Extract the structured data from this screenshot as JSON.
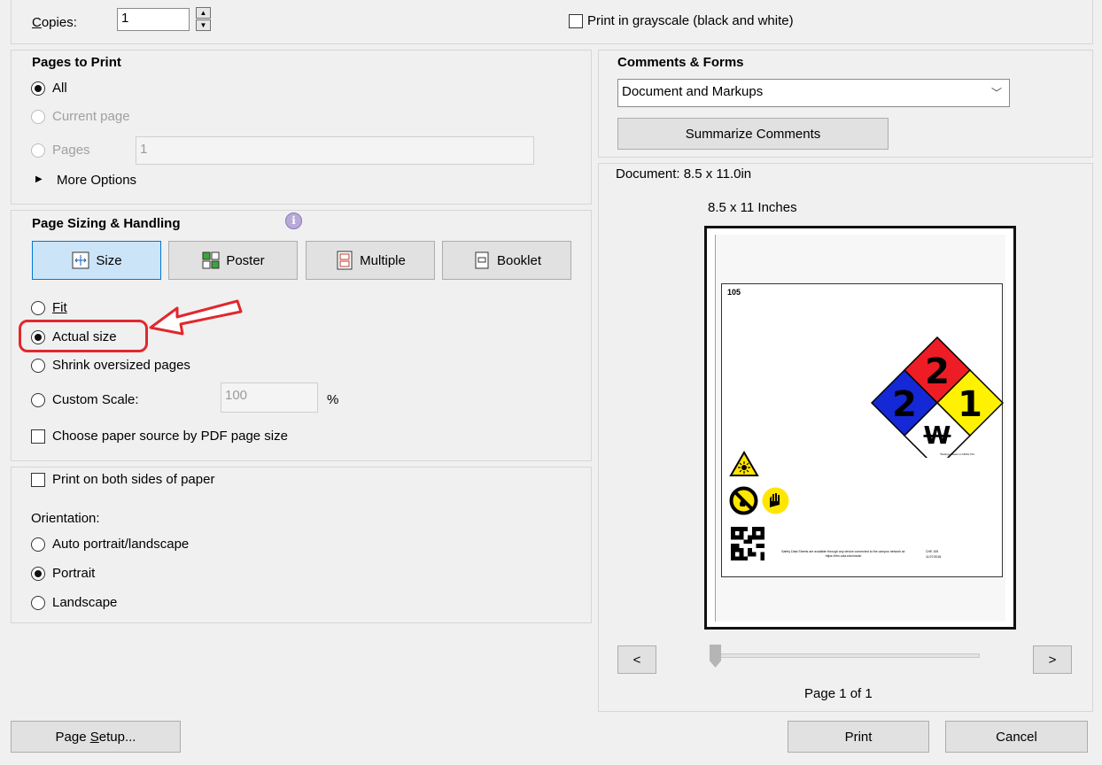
{
  "copies": {
    "label": "Copies:",
    "value": "1"
  },
  "grayscale": {
    "label": "Print in grayscale (black and white)",
    "checked": false
  },
  "pages_to_print": {
    "title": "Pages to Print",
    "all": "All",
    "current_page": "Current page",
    "pages": "Pages",
    "pages_value": "1",
    "more_options": "More Options"
  },
  "sizing": {
    "title": "Page Sizing & Handling",
    "tabs": [
      "Size",
      "Poster",
      "Multiple",
      "Booklet"
    ],
    "fit": "Fit",
    "actual_size": "Actual size",
    "shrink": "Shrink oversized pages",
    "custom_scale": "Custom Scale:",
    "custom_scale_value": "100",
    "percent": "%",
    "paper_source": "Choose paper source by PDF page size"
  },
  "duplex": {
    "both_sides": "Print on both sides of paper",
    "orientation_label": "Orientation:",
    "auto": "Auto portrait/landscape",
    "portrait": "Portrait",
    "landscape": "Landscape"
  },
  "comments_forms": {
    "title": "Comments & Forms",
    "selected": "Document and Markups",
    "summarize": "Summarize Comments"
  },
  "preview": {
    "document_size": "Document: 8.5 x 11.0in",
    "paper_size": "8.5 x 11 Inches",
    "page_label": "Page 1 of 1",
    "prev": "<",
    "next": ">",
    "page_progress": 0.0
  },
  "sheet": {
    "number": "105",
    "hazard": {
      "top": "2",
      "left": "2",
      "right": "1",
      "bottom": "W",
      "colors": {
        "top": "#ee1c25",
        "left": "#1428d6",
        "right": "#fff200",
        "bottom": "#ffffff"
      }
    },
    "ratings_note": "*Ratings based on NFPA 704",
    "footer_text": "Safety Data Sheets are available through any device connected to the campus network at: https://ehs.ucla.edu/msds/",
    "footer_code": "CHE 105",
    "footer_date": "11/27/2018"
  },
  "buttons": {
    "page_setup": "Page Setup...",
    "print": "Print",
    "cancel": "Cancel"
  },
  "annotation": {
    "color": "#e0282e"
  }
}
